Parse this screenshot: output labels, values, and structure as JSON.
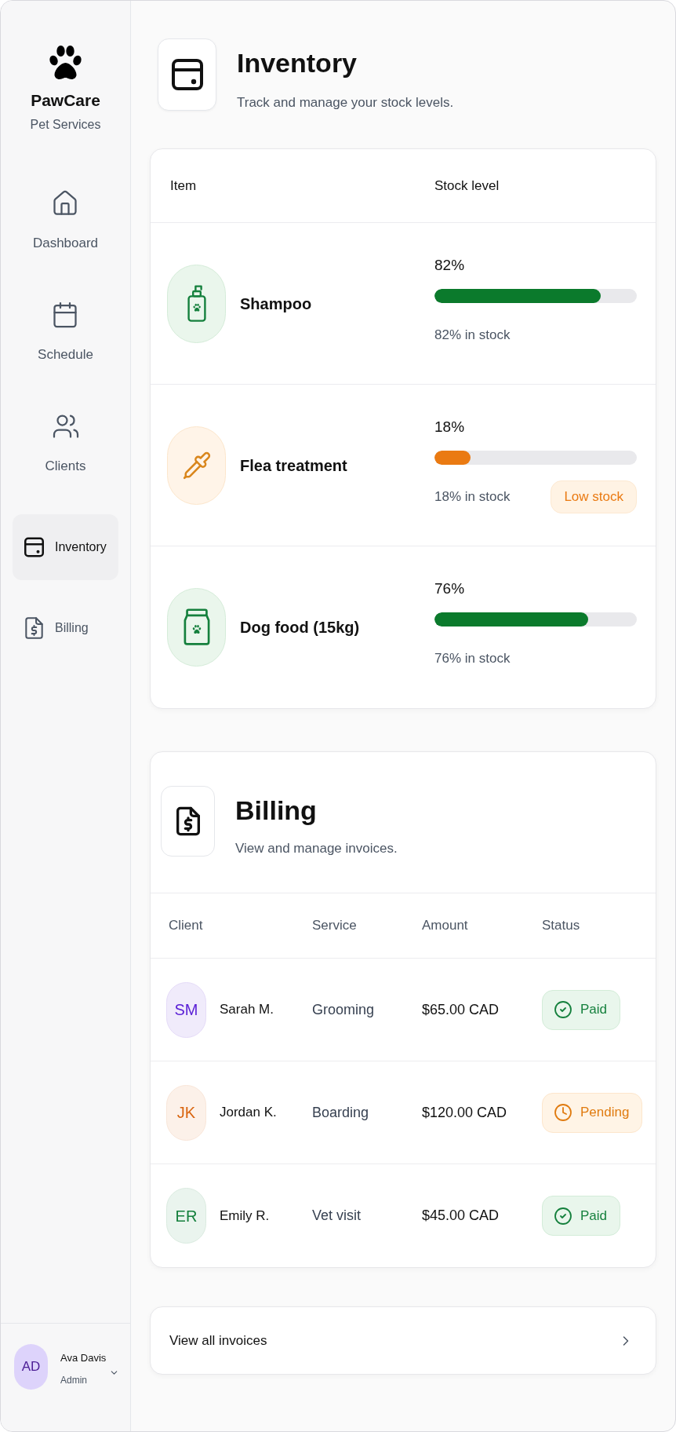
{
  "sidebar": {
    "brand": {
      "name": "PawCare",
      "tagline": "Pet Services"
    },
    "nav": [
      {
        "label": "Dashboard",
        "kind": "stacked",
        "selected": false
      },
      {
        "label": "Schedule",
        "kind": "stacked",
        "selected": false
      },
      {
        "label": "Clients",
        "kind": "stacked",
        "selected": false
      },
      {
        "label": "Inventory",
        "kind": "inline",
        "selected": true
      },
      {
        "label": "Billing",
        "kind": "inline",
        "selected": false
      }
    ],
    "user": {
      "initials": "AD",
      "name": "Ava Davis",
      "role": "Admin"
    }
  },
  "inventory": {
    "title": "Inventory",
    "subtitle": "Track and manage your stock levels.",
    "columns": [
      "Item",
      "Stock level"
    ],
    "items": [
      {
        "name": "Shampoo",
        "percent": "82%",
        "level": 0.82,
        "caption": "82% in stock",
        "low_stock": false
      },
      {
        "name": "Flea treatment",
        "percent": "18%",
        "level": 0.18,
        "caption": "18% in stock",
        "low_stock": true,
        "badge": "Low stock"
      },
      {
        "name": "Dog food (15kg)",
        "percent": "76%",
        "level": 0.76,
        "caption": "76% in stock",
        "low_stock": false
      }
    ]
  },
  "billing": {
    "title": "Billing",
    "subtitle": "View and manage invoices.",
    "columns": [
      "Client",
      "Service",
      "Amount",
      "Status"
    ],
    "rows": [
      {
        "initials": "SM",
        "color": "#5b21d6",
        "client": "Sarah M.",
        "service": "Grooming",
        "amount": "$65.00 CAD",
        "status": {
          "kind": "paid",
          "label": "Paid"
        }
      },
      {
        "initials": "JK",
        "color": "#d9650f",
        "client": "Jordan K.",
        "service": "Boarding",
        "amount": "$120.00 CAD",
        "status": {
          "kind": "pending",
          "label": "Pending"
        }
      },
      {
        "initials": "ER",
        "color": "#15803d",
        "client": "Emily R.",
        "service": "Vet visit",
        "amount": "$45.00 CAD",
        "status": {
          "kind": "paid",
          "label": "Paid"
        }
      }
    ]
  },
  "footer_link": {
    "label": "View all invoices"
  }
}
